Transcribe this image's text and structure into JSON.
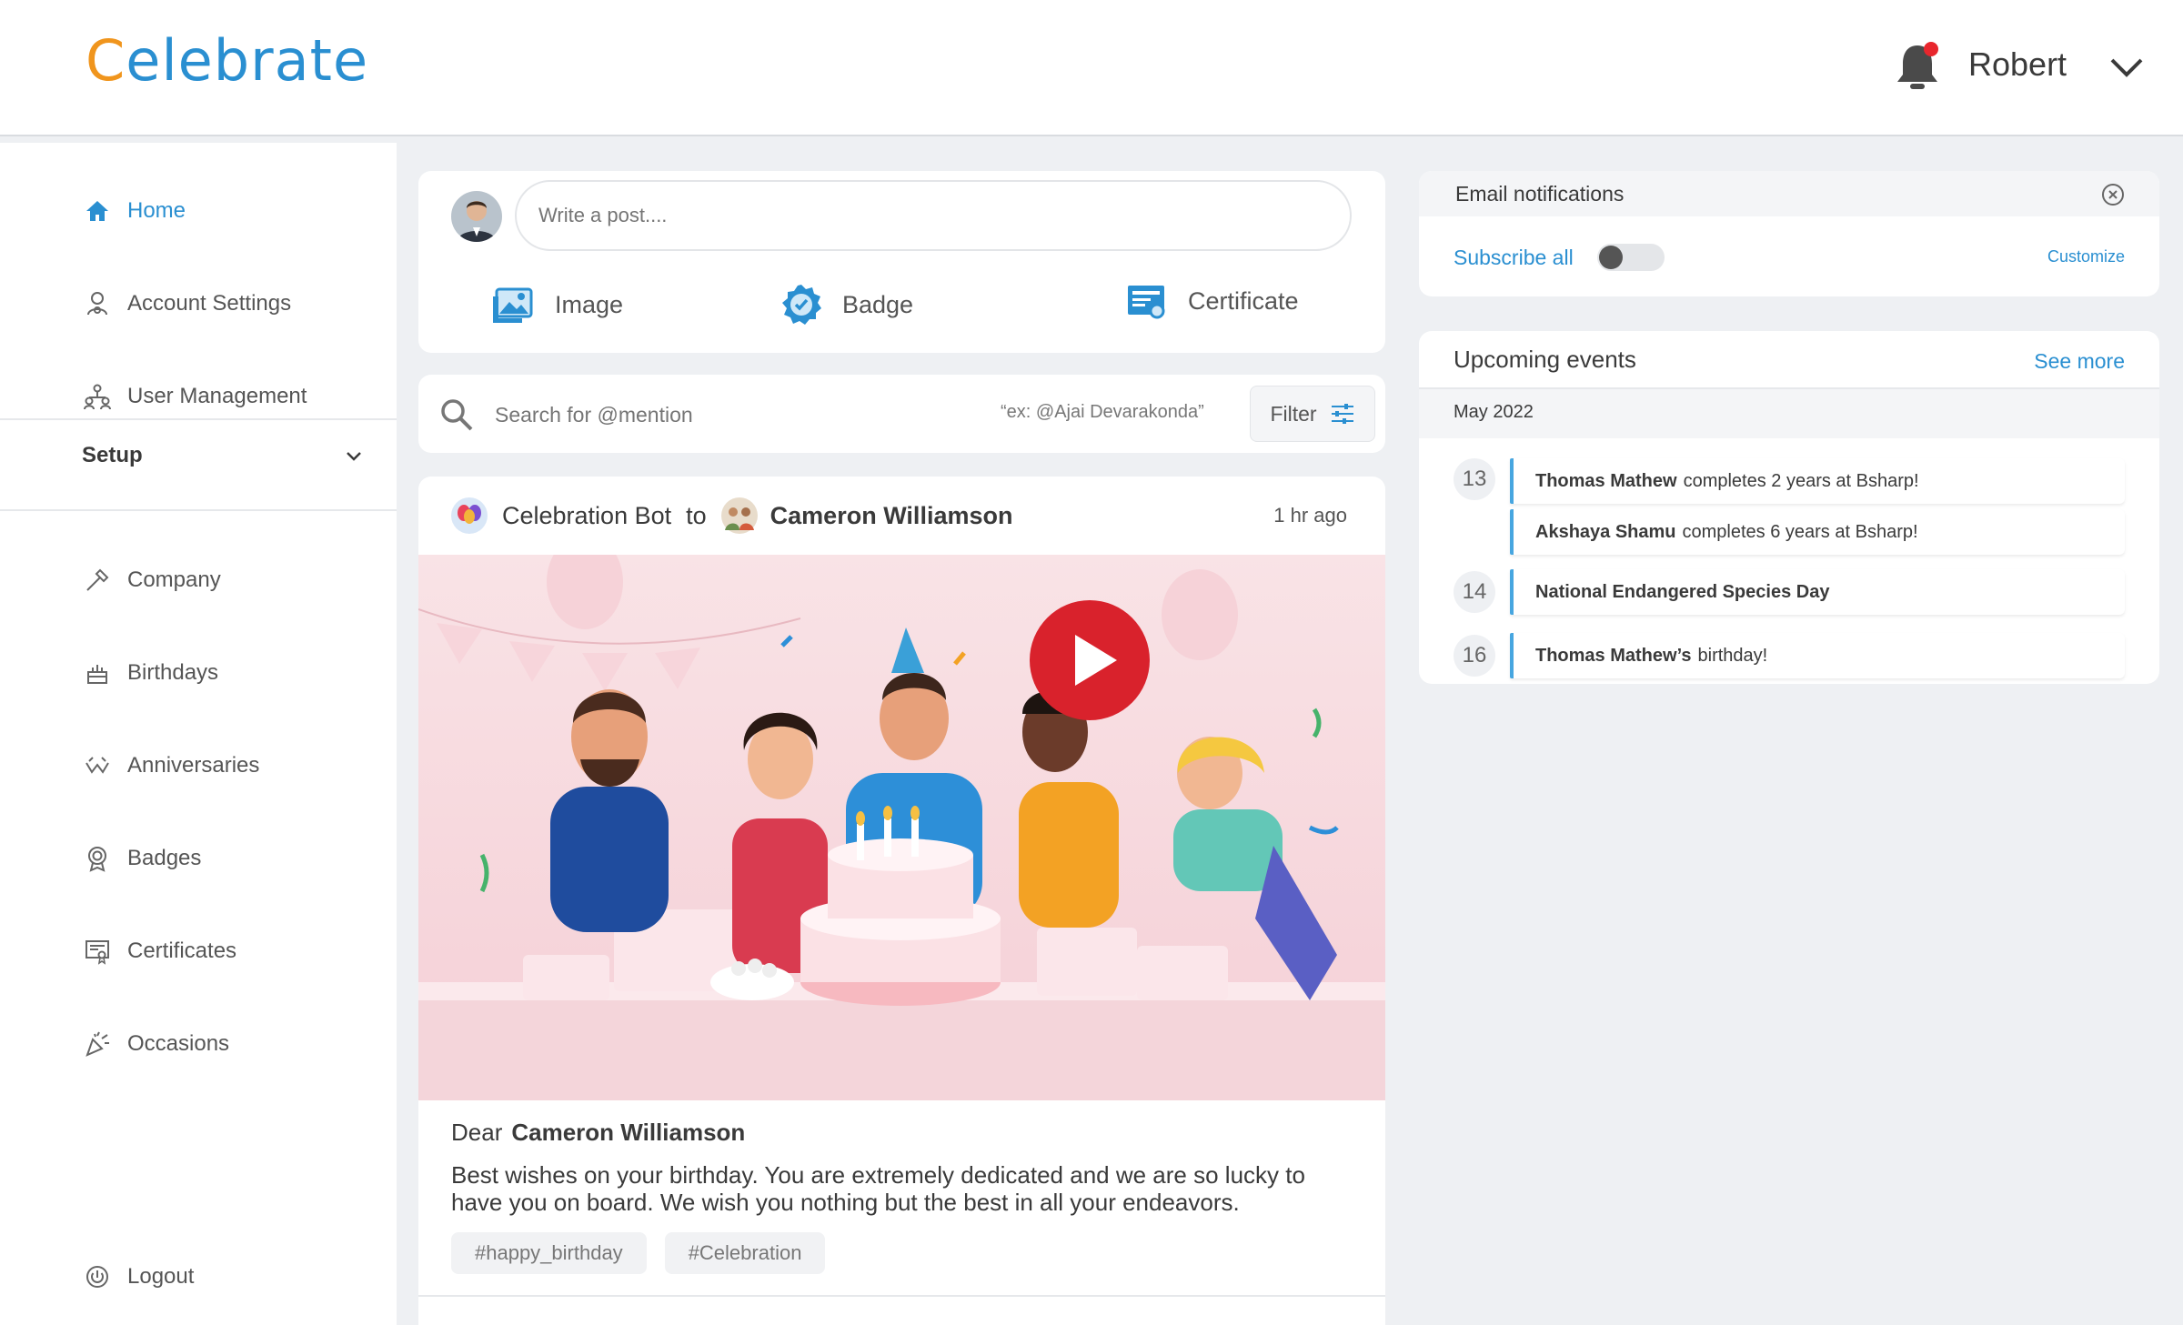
{
  "header": {
    "logo_initial": "C",
    "logo_rest": "elebrate",
    "user_name": "Robert"
  },
  "sidebar": {
    "items": [
      {
        "label": "Home",
        "icon": "home-icon"
      },
      {
        "label": "Account Settings",
        "icon": "account-settings-icon"
      },
      {
        "label": "User Management",
        "icon": "user-management-icon"
      }
    ],
    "setup_label": "Setup",
    "setup_items": [
      {
        "label": "Company",
        "icon": "company-icon"
      },
      {
        "label": "Birthdays",
        "icon": "birthday-cake-icon"
      },
      {
        "label": "Anniversaries",
        "icon": "anniversary-icon"
      },
      {
        "label": "Badges",
        "icon": "badge-icon"
      },
      {
        "label": "Certificates",
        "icon": "certificate-icon"
      },
      {
        "label": "Occasions",
        "icon": "party-popper-icon"
      }
    ],
    "logout_label": "Logout"
  },
  "composer": {
    "placeholder": "Write a post....",
    "actions": {
      "image": "Image",
      "badge": "Badge",
      "certificate": "Certificate"
    }
  },
  "search": {
    "placeholder": "Search for @mention",
    "hint": "“ex: @Ajai Devarakonda”",
    "filter_label": "Filter"
  },
  "post": {
    "sender": "Celebration Bot",
    "to": "to",
    "recipient": "Cameron Williamson",
    "time": "1 hr ago",
    "greeting": "Dear",
    "greeting_name": "Cameron Williamson",
    "message": "Best wishes on your birthday. You are extremely dedicated and we are so lucky to have you on board. We wish you nothing but the best in all your endeavors.",
    "tags": [
      "#happy_birthday",
      "#Celebration"
    ]
  },
  "email_notifications": {
    "title": "Email notifications",
    "subscribe_label": "Subscribe all",
    "subscribed": false,
    "customize_label": "Customize"
  },
  "events": {
    "title": "Upcoming events",
    "see_more": "See more",
    "month": "May 2022",
    "days": [
      "13",
      "14",
      "16"
    ],
    "items": [
      {
        "bold": "Thomas Mathew",
        "rest": "completes 2 years at Bsharp!"
      },
      {
        "bold": "Akshaya Shamu",
        "rest": "completes 6 years at Bsharp!"
      },
      {
        "bold": "National Endangered Species Day",
        "rest": ""
      },
      {
        "bold": "Thomas Mathew’s",
        "rest": "birthday!"
      }
    ]
  },
  "colors": {
    "accent": "#2a8fd1",
    "logo_orange": "#f0951d",
    "play_red": "#d9222c",
    "notify_red": "#e8262d"
  }
}
